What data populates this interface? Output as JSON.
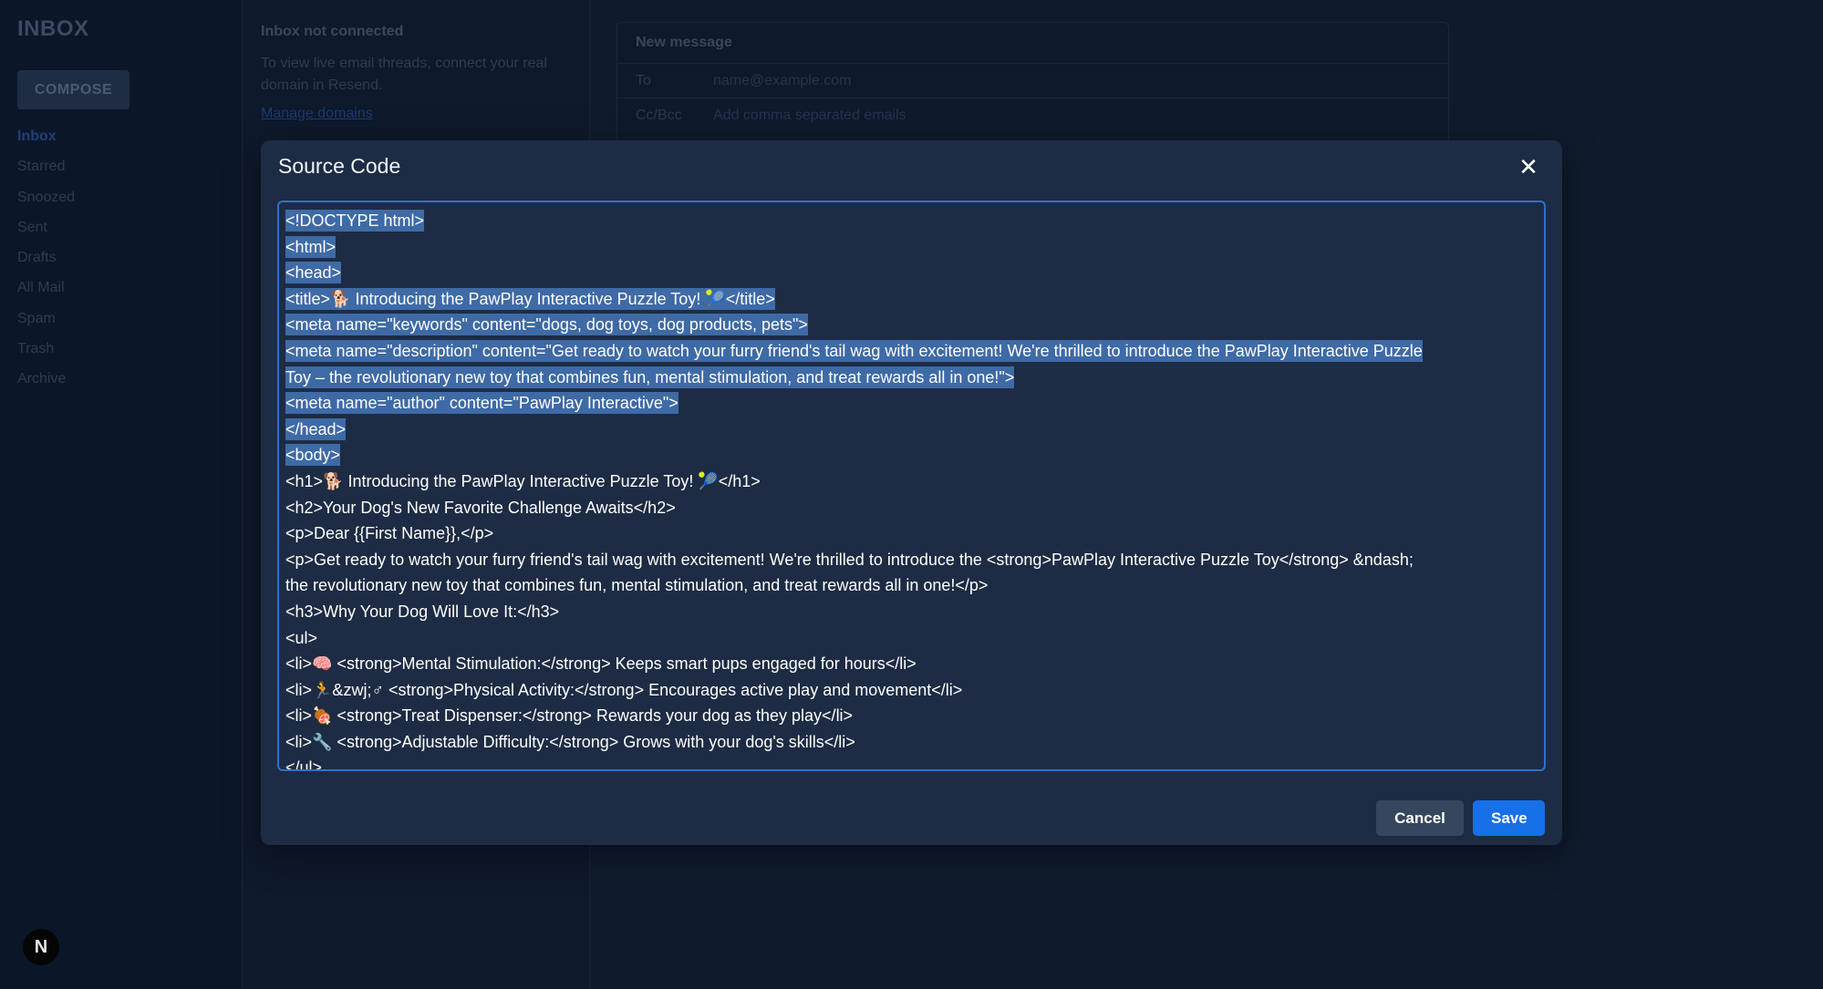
{
  "sidebar": {
    "app_title": "INBOX",
    "compose_label": "COMPOSE",
    "items": [
      {
        "label": "Inbox",
        "active": true
      },
      {
        "label": "Starred"
      },
      {
        "label": "Snoozed"
      },
      {
        "label": "Sent"
      },
      {
        "label": "Drafts"
      },
      {
        "label": "All Mail"
      },
      {
        "label": "Spam"
      },
      {
        "label": "Trash"
      },
      {
        "label": "Archive"
      }
    ],
    "avatar_letter": "N"
  },
  "inbox_notice": {
    "title": "Inbox not connected",
    "description": "To view live email threads, connect your real domain in Resend.",
    "link": "Manage domains"
  },
  "new_message": {
    "title": "New message",
    "to_label": "To",
    "to_placeholder": "name@example.com",
    "cc_label": "Cc/Bcc",
    "cc_placeholder": "Add comma separated emails"
  },
  "modal": {
    "title": "Source Code",
    "close_icon": "close-icon",
    "cancel_label": "Cancel",
    "save_label": "Save",
    "accent_color": "#1670e8",
    "selection_color": "#3e6aa6",
    "code_lines": [
      "<!DOCTYPE html>",
      "<html>",
      "<head>",
      "<title>🐕 Introducing the PawPlay Interactive Puzzle Toy! 🎾</title>",
      "<meta name=\"keywords\" content=\"dogs, dog toys, dog products, pets\">",
      "<meta name=\"description\" content=\"Get ready to watch your furry friend's tail wag with excitement! We're thrilled to introduce the PawPlay Interactive Puzzle",
      "Toy – the revolutionary new toy that combines fun, mental stimulation, and treat rewards all in one!\">",
      "<meta name=\"author\" content=\"PawPlay Interactive\">",
      "</head>",
      "<body>",
      "<h1>🐕 Introducing the PawPlay Interactive Puzzle Toy! 🎾</h1>",
      "<h2>Your Dog's New Favorite Challenge Awaits</h2>",
      "<p>Dear {{First Name}},</p>",
      "<p>Get ready to watch your furry friend's tail wag with excitement! We're thrilled to introduce the <strong>PawPlay Interactive Puzzle Toy</strong> &ndash;",
      "the revolutionary new toy that combines fun, mental stimulation, and treat rewards all in one!</p>",
      "<h3>Why Your Dog Will Love It:</h3>",
      "<ul>",
      "<li>🧠 <strong>Mental Stimulation:</strong> Keeps smart pups engaged for hours</li>",
      "<li>🏃&zwj;♂ <strong>Physical Activity:</strong> Encourages active play and movement</li>",
      "<li>🍖 <strong>Treat Dispenser:</strong> Rewards your dog as they play</li>",
      "<li>🔧 <strong>Adjustable Difficulty:</strong> Grows with your dog's skills</li>",
      "</ul>"
    ],
    "selected_line_count": 10
  }
}
